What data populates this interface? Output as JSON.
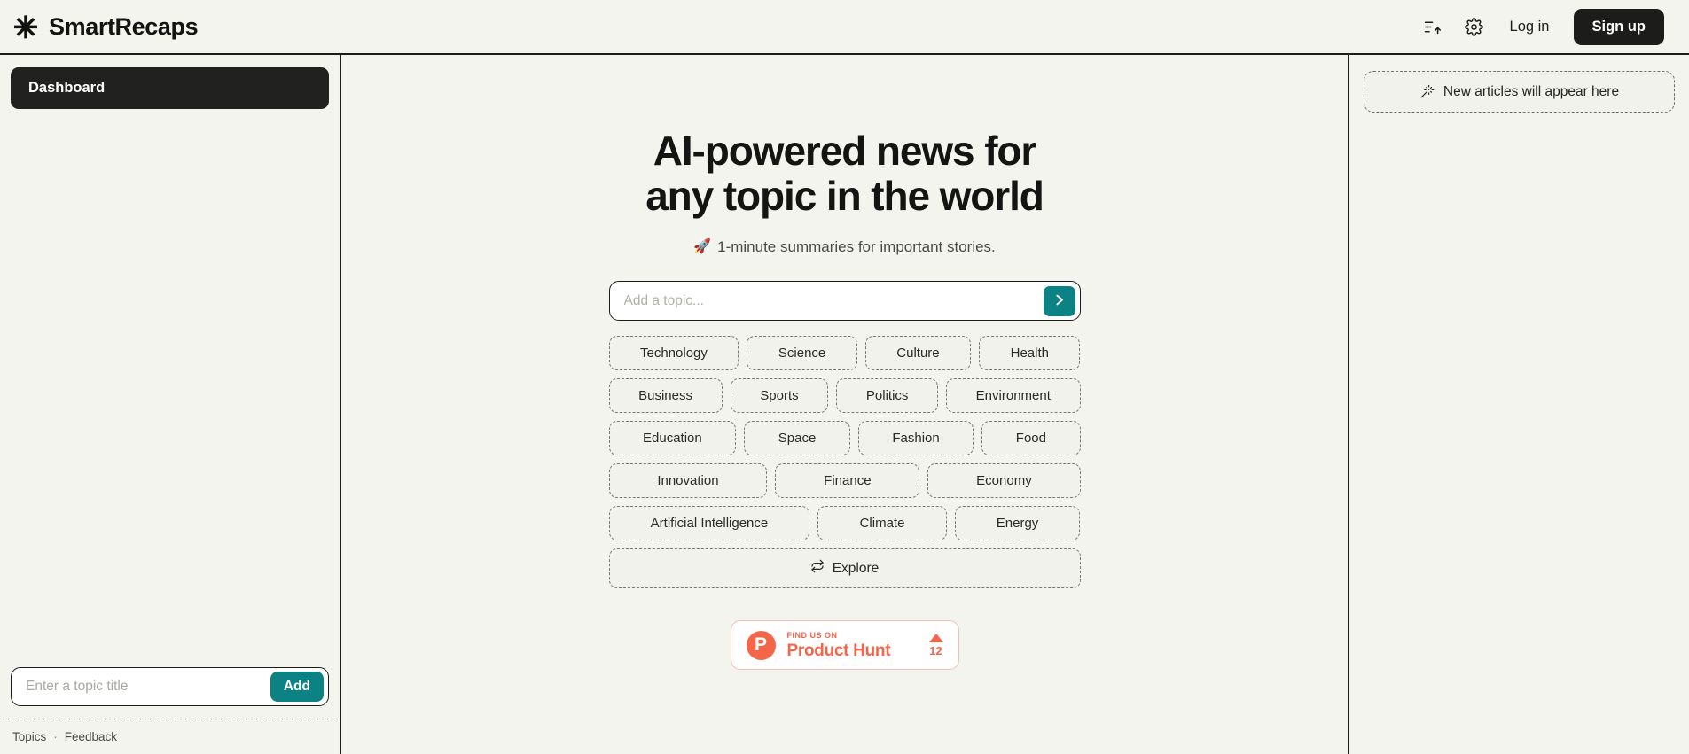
{
  "header": {
    "brand_name": "SmartRecaps",
    "brand_icon": "asterisk-logo-icon",
    "sort_icon": "sort-ascending-icon",
    "settings_icon": "gear-icon",
    "login_label": "Log in",
    "signup_label": "Sign up"
  },
  "sidebar": {
    "nav_items": [
      {
        "label": "Dashboard",
        "active": true
      }
    ],
    "add_topic": {
      "placeholder": "Enter a topic title",
      "value": "",
      "button_label": "Add"
    },
    "footer": {
      "topics_label": "Topics",
      "separator": "·",
      "feedback_label": "Feedback"
    }
  },
  "main": {
    "hero_title": "AI-powered news for any topic in the world",
    "hero_subtitle": "1-minute summaries for important stories.",
    "hero_subtitle_emoji": "🚀",
    "search": {
      "placeholder": "Add a topic...",
      "value": "",
      "submit_icon": "chevron-right-icon"
    },
    "topic_rows": [
      [
        "Technology",
        "Science",
        "Culture",
        "Health"
      ],
      [
        "Business",
        "Sports",
        "Politics",
        "Environment"
      ],
      [
        "Education",
        "Space",
        "Fashion",
        "Food"
      ],
      [
        "Innovation",
        "Finance",
        "Economy"
      ],
      [
        "Artificial Intelligence",
        "Climate",
        "Energy"
      ]
    ],
    "explore": {
      "label": "Explore",
      "icon": "shuffle-refresh-icon"
    },
    "product_hunt": {
      "kicker": "FIND US ON",
      "name": "Product Hunt",
      "logo_letter": "P",
      "upvote_count": "12"
    }
  },
  "right_panel": {
    "empty_state_text": "New articles will appear here",
    "empty_state_icon": "sparkle-wand-icon"
  },
  "colors": {
    "page_background": "#f4f4ef",
    "ink": "#1c1c1a",
    "accent_teal": "#0d8285",
    "product_hunt_red": "#f4654a",
    "muted_text": "#4b4b46"
  }
}
